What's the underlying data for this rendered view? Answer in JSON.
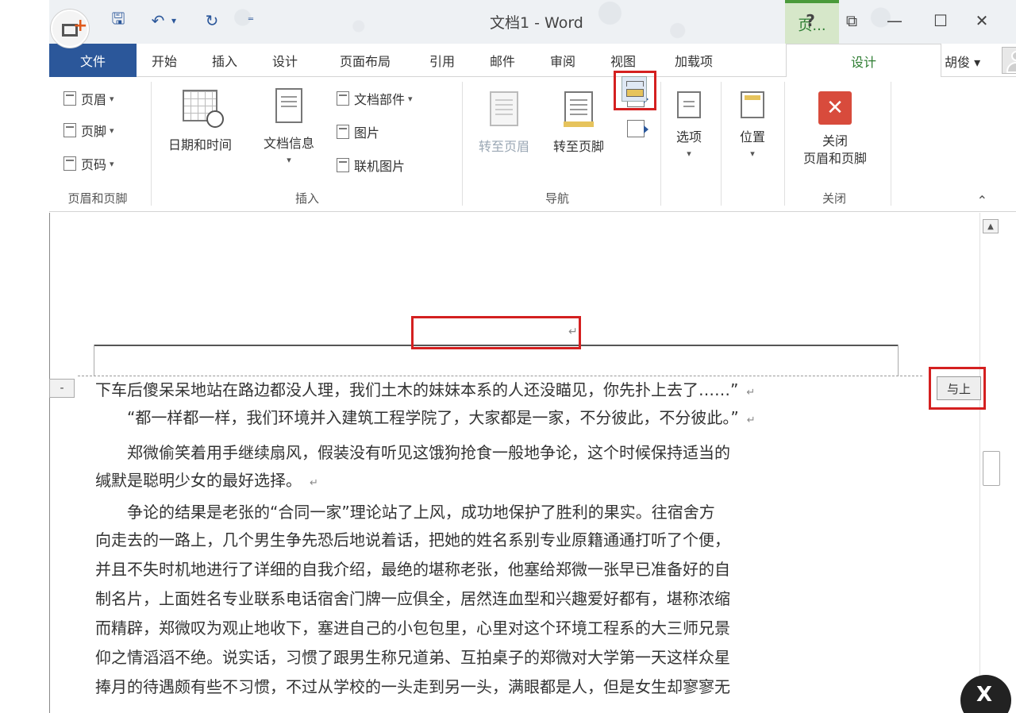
{
  "title_bar": {
    "doc_title": "文档1 - Word",
    "context_tab": "页...",
    "help": "?",
    "restore": "⧉",
    "minimize": "—",
    "maximize": "☐",
    "close": "✕"
  },
  "qat": {
    "save": "🖫",
    "undo": "↶",
    "undo_arrow": "▾",
    "redo": "↻",
    "customize": "⁼"
  },
  "tabs": {
    "file": "文件",
    "items": [
      "开始",
      "插入",
      "设计",
      "页面布局",
      "引用",
      "邮件",
      "审阅",
      "视图",
      "加载项"
    ],
    "context_design": "设计",
    "user": "胡俊 ▾"
  },
  "ribbon": {
    "header_footer_group": {
      "label": "页眉和页脚",
      "header": "页眉",
      "footer": "页脚",
      "page_number": "页码"
    },
    "insert_group": {
      "label": "插入",
      "datetime": "日期和时间",
      "docinfo": "文档信息",
      "quickparts": "文档部件",
      "picture": "图片",
      "online_picture": "联机图片"
    },
    "navigation_group": {
      "label": "导航",
      "goto_header": "转至页眉",
      "goto_footer": "转至页脚"
    },
    "options": "选项",
    "position": "位置",
    "close_group": {
      "label": "关闭",
      "close_line1": "关闭",
      "close_line2": "页眉和页脚"
    }
  },
  "document": {
    "header_tag": "-",
    "same_as_previous": "与上",
    "paragraphs": [
      "下车后傻呆呆地站在路边都没人理，我们土木的妹妹本系的人还没瞄见，你先扑上去了……”",
      "　　“都一样都一样，我们环境并入建筑工程学院了，大家都是一家，不分彼此，不分彼此。”",
      "　　郑微偷笑着用手继续扇风，假装没有听见这饿狗抢食一般地争论，这个时候保持适当的",
      "缄默是聪明少女的最好选择。",
      "　　争论的结果是老张的“合同一家”理论站了上风，成功地保护了胜利的果实。往宿舍方",
      "向走去的一路上，几个男生争先恐后地说着话，把她的姓名系别专业原籍通通打听了个便，",
      "并且不失时机地进行了详细的自我介绍，最绝的堪称老张，他塞给郑微一张早已准备好的自",
      "制名片，上面姓名专业联系电话宿舍门牌一应俱全，居然连血型和兴趣爱好都有，堪称浓缩",
      "而精辟，郑微叹为观止地收下，塞进自己的小包包里，心里对这个环境工程系的大三师兄景",
      "仰之情滔滔不绝。说实话，习惯了跟男生称兄道弟、互拍桌子的郑微对大学第一天这样众星",
      "捧月的待遇颇有些不习惯，不过从学校的一头走到另一头，满眼都是人，但是女生却寥寥无"
    ],
    "para_mark": "↵"
  },
  "overlay": {
    "close": "X"
  }
}
